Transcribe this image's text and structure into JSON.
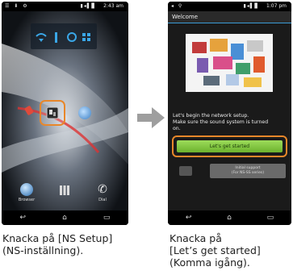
{
  "left_phone": {
    "status_time": "2:43 am",
    "status_left_icons": "☰ ⬇ ⚙",
    "status_signal": "▮◂▌▊",
    "ns_setup_icon": "ns-setup-icon",
    "dock": {
      "browser_label": "Browser",
      "dial_label": "Dial"
    }
  },
  "right_phone": {
    "status_time": "1:07 pm",
    "status_left_icons": "◂ ⚲",
    "status_signal": "▮◂▌▊",
    "header_title": "Welcome",
    "body_text": "Let's begin the network setup.\nMake sure the sound system is turned\non.",
    "primary_button": "Let's get started",
    "secondary_button": "Initial support\n(For NS-SS series)"
  },
  "captions": {
    "left": "Knacka på [NS Setup]\n(NS-inställning).",
    "right": "Knacka på\n[Let’s get started]\n(Komma igång)."
  },
  "colors": {
    "highlight": "#e8872a",
    "green_button": "#7ec43a",
    "arrow": "#9e9e9e"
  }
}
